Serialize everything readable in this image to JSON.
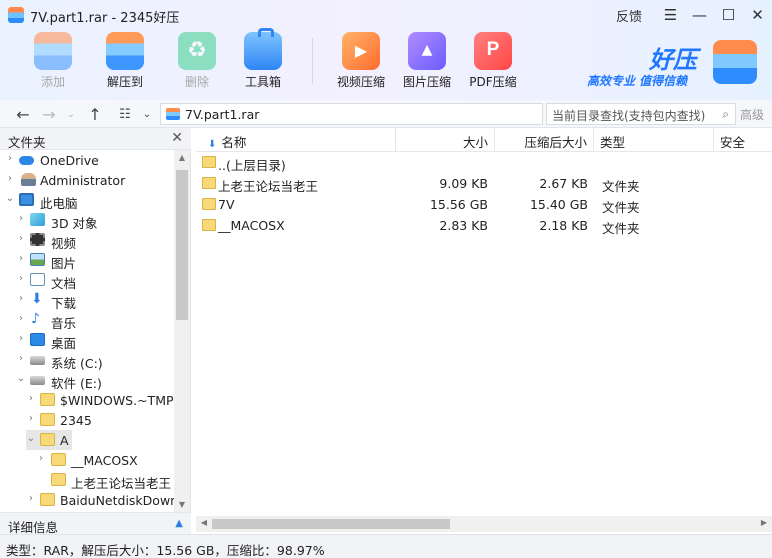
{
  "window": {
    "title": "7V.part1.rar - 2345好压",
    "feedback": "反馈",
    "controls": [
      "menu-icon",
      "minimize-icon",
      "maximize-icon",
      "close-icon"
    ]
  },
  "toolbar": {
    "add": "添加",
    "extract_to": "解压到",
    "delete": "删除",
    "toolbox": "工具箱",
    "video_compress": "视频压缩",
    "image_compress": "图片压缩",
    "pdf_compress": "PDF压缩"
  },
  "brand": {
    "name": "好压",
    "slogan": "高效专业 值得信赖"
  },
  "address": {
    "path": "7V.part1.rar",
    "search_placeholder": "当前目录查找(支持包内查找)",
    "advanced": "高级"
  },
  "left_panel": {
    "title": "文件夹",
    "footer": "详细信息",
    "tree": [
      {
        "label": "OneDrive",
        "icon": "cloud-icon",
        "expanded": false
      },
      {
        "label": "Administrator",
        "icon": "user-icon",
        "expanded": false
      },
      {
        "label": "此电脑",
        "icon": "computer-icon",
        "expanded": true
      },
      {
        "label": "3D 对象",
        "icon": "3d-objects-icon",
        "expanded": false
      },
      {
        "label": "视频",
        "icon": "video-icon",
        "expanded": false
      },
      {
        "label": "图片",
        "icon": "picture-icon",
        "expanded": false
      },
      {
        "label": "文档",
        "icon": "document-icon",
        "expanded": false
      },
      {
        "label": "下载",
        "icon": "download-icon",
        "expanded": false
      },
      {
        "label": "音乐",
        "icon": "music-icon",
        "expanded": false
      },
      {
        "label": "桌面",
        "icon": "desktop-icon",
        "expanded": false
      },
      {
        "label": "系统 (C:)",
        "icon": "drive-icon",
        "expanded": false
      },
      {
        "label": "软件 (E:)",
        "icon": "drive-icon",
        "expanded": true
      },
      {
        "label": "$WINDOWS.~TMP",
        "icon": "folder-icon",
        "expanded": false
      },
      {
        "label": "2345",
        "icon": "folder-icon",
        "expanded": false
      },
      {
        "label": "A",
        "icon": "folder-icon",
        "expanded": true,
        "selected": true
      },
      {
        "label": "__MACOSX",
        "icon": "folder-icon",
        "expanded": false
      },
      {
        "label": "上老王论坛当老王",
        "icon": "folder-icon",
        "expanded": false
      },
      {
        "label": "BaiduNetdiskDownl",
        "icon": "folder-icon",
        "expanded": false
      }
    ]
  },
  "file_list": {
    "columns": {
      "name": "名称",
      "size": "大小",
      "packed": "压缩后大小",
      "type": "类型",
      "security": "安全"
    },
    "rows": [
      {
        "name": "..(上层目录)",
        "size": "",
        "packed": "",
        "type": ""
      },
      {
        "name": "上老王论坛当老王",
        "size": "9.09 KB",
        "packed": "2.67 KB",
        "type": "文件夹"
      },
      {
        "name": "7V",
        "size": "15.56 GB",
        "packed": "15.40 GB",
        "type": "文件夹"
      },
      {
        "name": "__MACOSX",
        "size": "2.83 KB",
        "packed": "2.18 KB",
        "type": "文件夹"
      }
    ]
  },
  "status": {
    "text": "类型：RAR，解压后大小：15.56 GB，压缩比：98.97%"
  }
}
